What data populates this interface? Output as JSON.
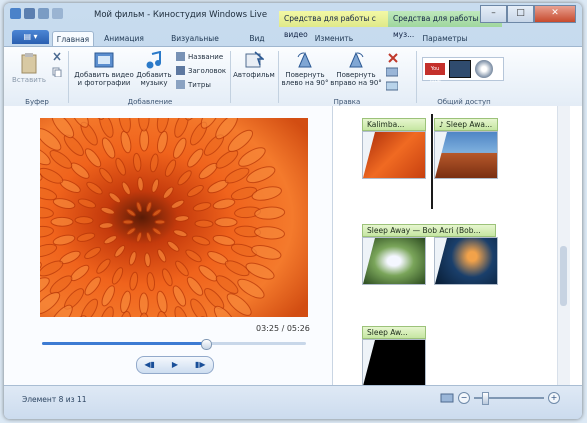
{
  "window": {
    "title": "Мой фильм - Киностудия Windows Live",
    "context_tabs": [
      "Средства для работы с видео",
      "Средства для работы с муз..."
    ],
    "buttons": {
      "minimize": "–",
      "maximize": "□",
      "close": "✕"
    }
  },
  "tabs": {
    "file": "▤ ▾",
    "items": [
      {
        "label": "Главная",
        "active": true
      },
      {
        "label": "Анимация"
      },
      {
        "label": "Визуальные эффекты"
      },
      {
        "label": "Вид"
      },
      {
        "label": "Изменить"
      },
      {
        "label": "Параметры"
      }
    ]
  },
  "ribbon": {
    "clipboard": {
      "paste": "Вставить",
      "group": "Буфер"
    },
    "add": {
      "add_video": "Добавить видео и фотографии",
      "add_music": "Добавить музыку",
      "title": "Название",
      "caption": "Заголовок",
      "credits": "Титры",
      "group": "Добавление"
    },
    "automovie": "Автофильм",
    "editing": {
      "rotate_left": "Повернуть влево на 90°",
      "rotate_right": "Повернуть вправо на 90°",
      "group": "Правка"
    },
    "share": {
      "youtube": "You Tube",
      "group": "Общий доступ"
    }
  },
  "preview": {
    "time": "03:25 / 05:26",
    "progress": 0.62
  },
  "storyboard": {
    "clips": [
      {
        "caption": "Kalimba..."
      },
      {
        "caption": "♪ Sleep Awa..."
      },
      {
        "caption": "Sleep Away — Bob Acri (Bob..."
      },
      {
        "caption": "Sleep Aw..."
      }
    ]
  },
  "status": {
    "text": "Элемент 8 из 11",
    "zoom_minus": "−",
    "zoom_plus": "+"
  },
  "colors": {
    "accent": "#2a5fb0",
    "video_tools": "#e8ef95",
    "music_tools": "#aedfac",
    "clip_caption": "#d6efb8"
  }
}
